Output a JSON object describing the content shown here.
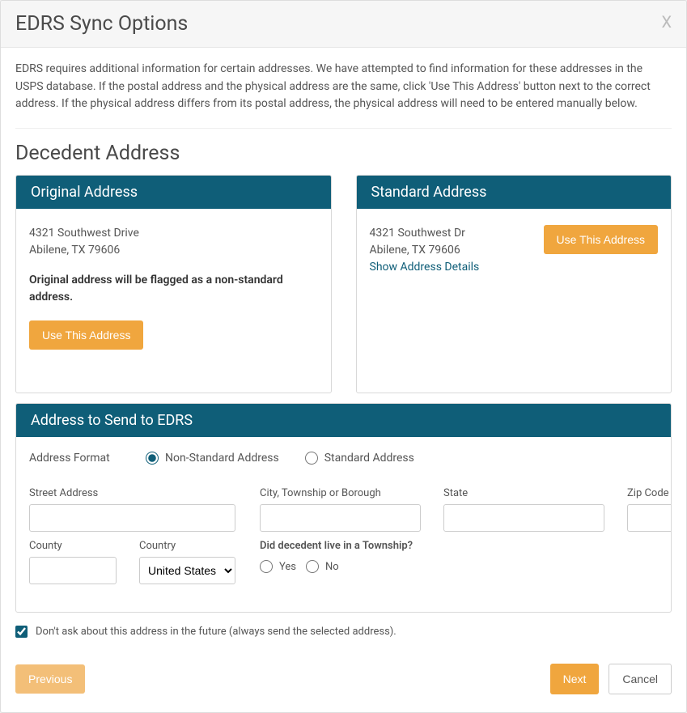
{
  "modal": {
    "title": "EDRS Sync Options",
    "close": "X",
    "intro": "EDRS requires additional information for certain addresses. We have attempted to find information for these addresses in the USPS database. If the postal address and the physical address are the same, click 'Use This Address' button next to the correct address. If the physical address differs from its postal address, the physical address will need to be entered manually below."
  },
  "section": {
    "decedent_title": "Decedent Address"
  },
  "original_card": {
    "header": "Original Address",
    "line1": "4321 Southwest Drive",
    "line2": "Abilene, TX 79606",
    "warning": "Original address will be flagged as a non-standard address.",
    "use_btn": "Use This Address"
  },
  "standard_card": {
    "header": "Standard Address",
    "line1": "4321 Southwest Dr",
    "line2": "Abilene, TX 79606",
    "details_link": "Show Address Details",
    "use_btn": "Use This Address"
  },
  "send_card": {
    "header": "Address to Send to EDRS",
    "format_label": "Address Format",
    "format_nonstandard": "Non-Standard Address",
    "format_standard": "Standard Address",
    "street_label": "Street Address",
    "city_label": "City, Township or Borough",
    "state_label": "State",
    "zip_label": "Zip Code",
    "county_label": "County",
    "country_label": "Country",
    "country_value": "United States",
    "township_q": "Did decedent live in a Township?",
    "township_yes": "Yes",
    "township_no": "No"
  },
  "future": {
    "label": "Don't ask about this address in the future (always send the selected address)."
  },
  "footer": {
    "prev": "Previous",
    "next": "Next",
    "cancel": "Cancel"
  }
}
